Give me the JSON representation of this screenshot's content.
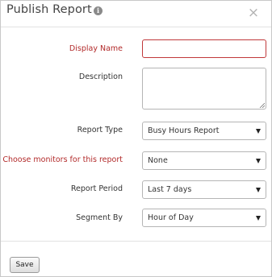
{
  "dialog": {
    "title": "Publish Report",
    "close_glyph": "×",
    "info_glyph": "i"
  },
  "form": {
    "display_name": {
      "label": "Display Name",
      "value": "",
      "placeholder": ""
    },
    "description": {
      "label": "Description",
      "value": ""
    },
    "report_type": {
      "label": "Report Type",
      "selected": "Busy Hours Report"
    },
    "monitors": {
      "label": "Choose monitors for this report",
      "selected": "None"
    },
    "report_period": {
      "label": "Report Period",
      "selected": "Last 7 days"
    },
    "segment_by": {
      "label": "Segment By",
      "selected": "Hour of Day"
    }
  },
  "footer": {
    "save_label": "Save"
  },
  "colors": {
    "required_label": "#b22a2a",
    "error_border": "#c0383a",
    "border": "#b5b5b5"
  }
}
